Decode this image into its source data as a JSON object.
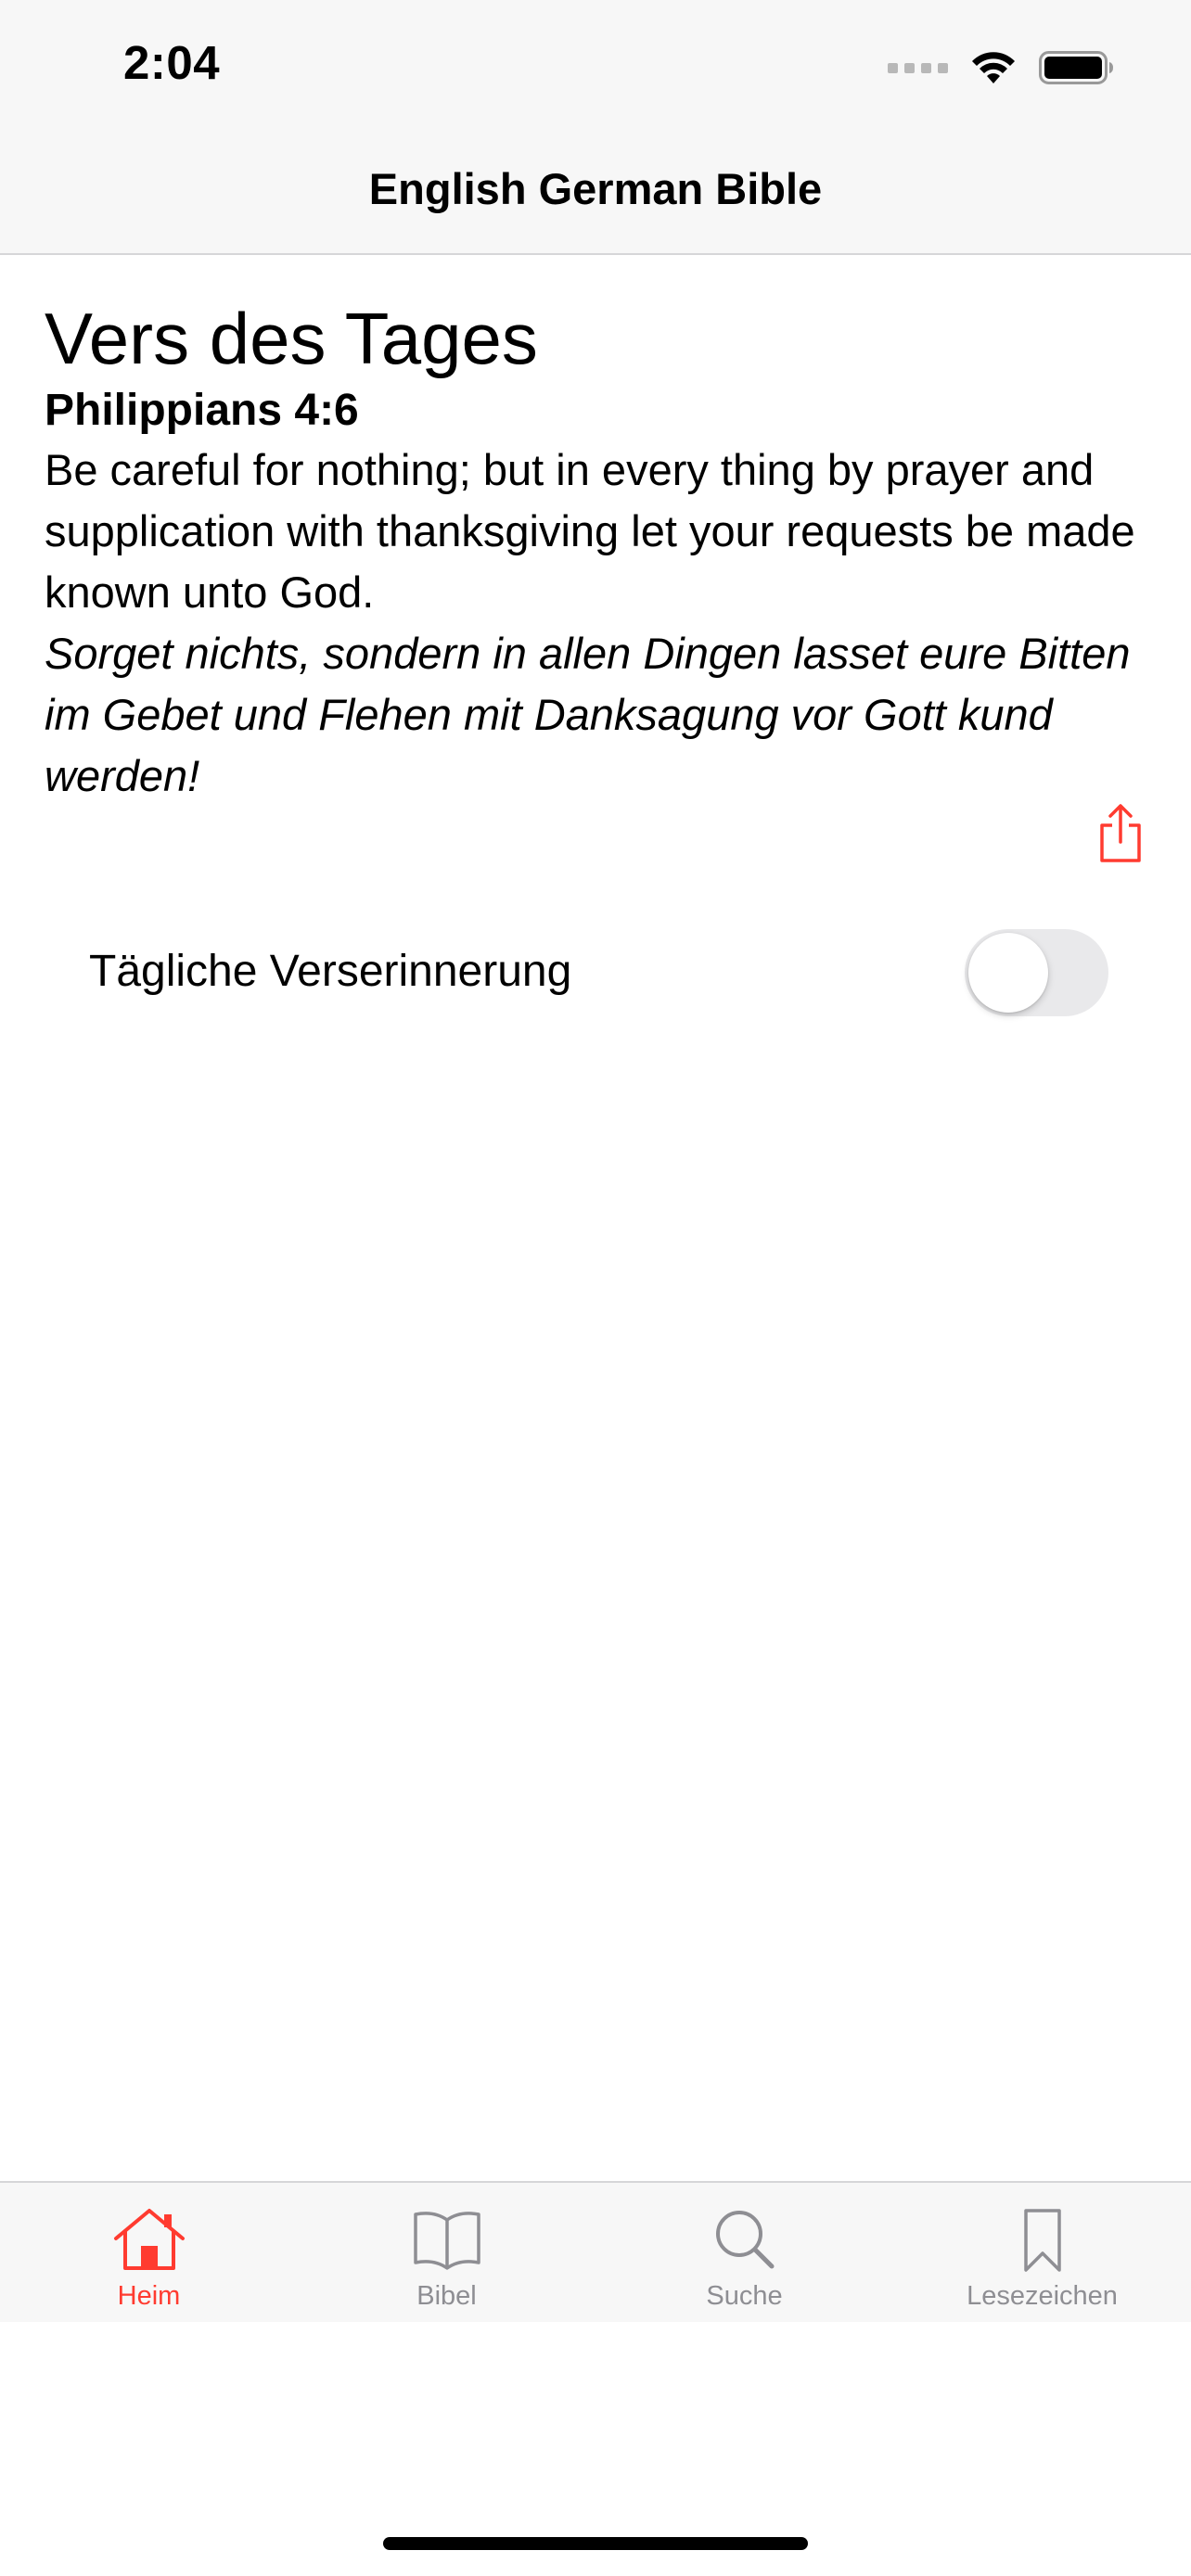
{
  "status_bar": {
    "time": "2:04"
  },
  "nav": {
    "title": "English German Bible"
  },
  "verse_of_day": {
    "heading": "Vers des Tages",
    "reference": "Philippians 4:6",
    "english_text": "Be careful for nothing; but in every thing by prayer and supplication with thanksgiving let your requests be made known unto God.",
    "german_text": "Sorget nichts, sondern in allen Dingen lasset eure Bitten im Gebet und Flehen mit Danksagung vor Gott kund werden!",
    "share_icon": "share-icon"
  },
  "reminder": {
    "label": "Tägliche Verserinnerung",
    "enabled": false
  },
  "tabs": [
    {
      "label": "Heim",
      "icon": "house-icon",
      "active": true
    },
    {
      "label": "Bibel",
      "icon": "book-icon",
      "active": false
    },
    {
      "label": "Suche",
      "icon": "magnifier-icon",
      "active": false
    },
    {
      "label": "Lesezeichen",
      "icon": "bookmark-icon",
      "active": false
    }
  ],
  "colors": {
    "accent": "#ff3b30",
    "inactive": "#8e8e93",
    "bar_background": "#f7f7f7"
  }
}
